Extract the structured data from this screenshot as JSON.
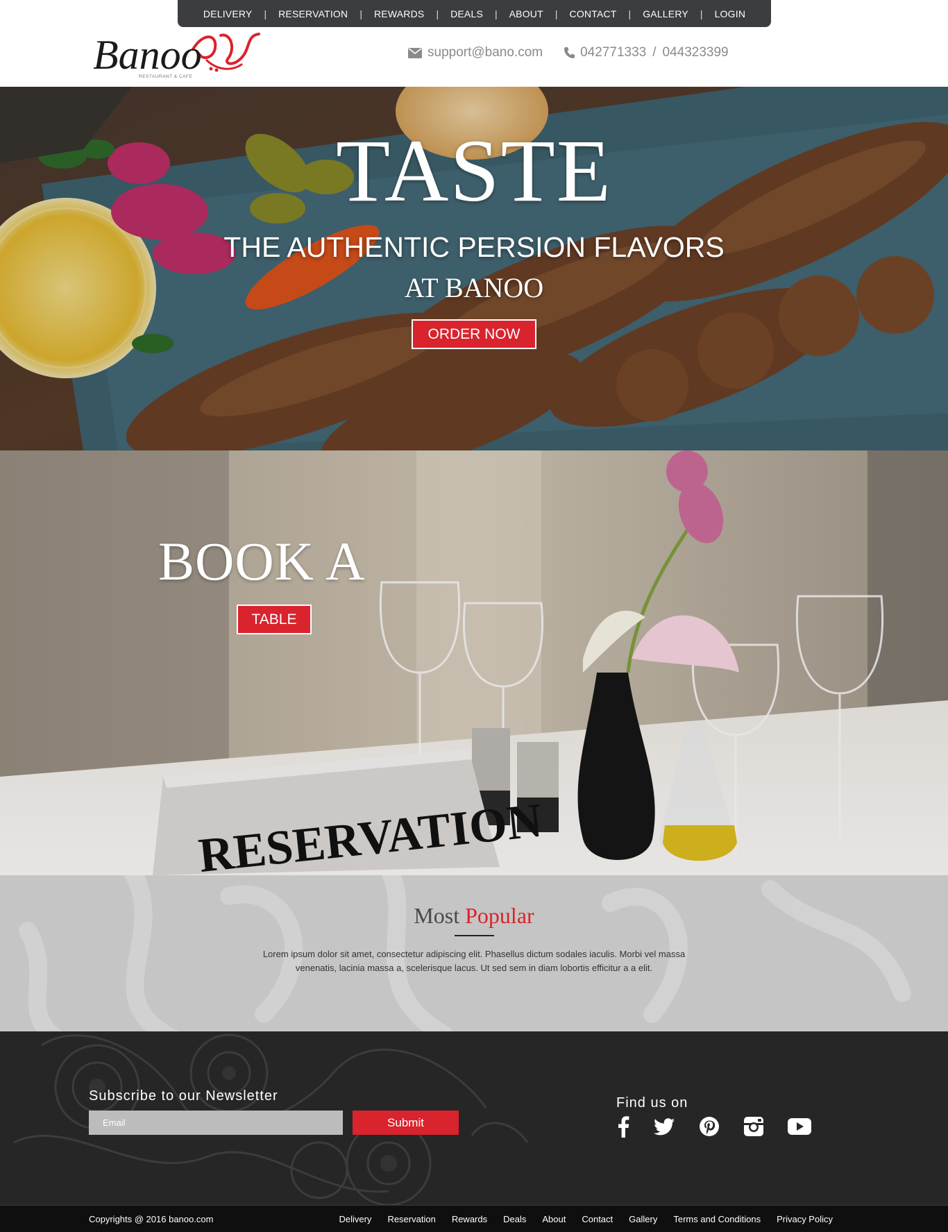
{
  "nav": {
    "items": [
      "DELIVERY",
      "RESERVATION",
      "REWARDS",
      "DEALS",
      "ABOUT",
      "CONTACT",
      "GALLERY",
      "LOGIN"
    ]
  },
  "header": {
    "brand": "Banoo",
    "brand_tagline": "RESTAURANT & CAFE",
    "email": "support@bano.com",
    "phone1": "042771333",
    "phone_separator": "/",
    "phone2": "044323399"
  },
  "hero": {
    "title": "TASTE",
    "subtitle": "THE AUTHENTIC PERSION FLAVORS",
    "subtitle2": "AT BANOO",
    "cta": "ORDER NOW"
  },
  "booking": {
    "title": "BOOK A",
    "cta": "TABLE",
    "sign_text": "RESERVATION"
  },
  "popular": {
    "title_plain": "Most",
    "title_accent": "Popular",
    "text": "Lorem ipsum dolor sit amet, consectetur adipiscing elit. Phasellus dictum sodales iaculis. Morbi vel massa venenatis, lacinia massa a, scelerisque lacus. Ut sed sem in diam lobortis efficitur a a elit."
  },
  "newsletter": {
    "title": "Subscribe to our Newsletter",
    "placeholder": "Email",
    "submit": "Submit"
  },
  "social": {
    "title": "Find us on",
    "icons": [
      "facebook-icon",
      "twitter-icon",
      "pinterest-icon",
      "instagram-icon",
      "youtube-icon"
    ]
  },
  "bottom": {
    "copyright": "Copyrights @ 2016 banoo.com",
    "links": [
      "Delivery",
      "Reservation",
      "Rewards",
      "Deals",
      "About",
      "Contact",
      "Gallery",
      "Terms and Conditions",
      "Privacy Policy"
    ]
  },
  "colors": {
    "accent": "#d9232d",
    "nav_bg": "#3b3d40",
    "footer_bg": "#262626"
  }
}
